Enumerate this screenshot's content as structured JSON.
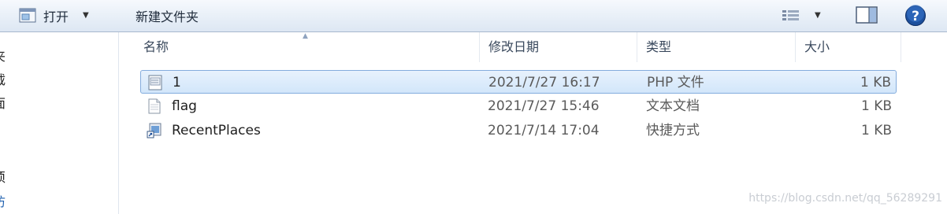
{
  "toolbar": {
    "open_label": "打开",
    "new_folder_label": "新建文件夹"
  },
  "nav": {
    "items": [
      "夹",
      "载",
      "面",
      "须",
      "访"
    ]
  },
  "columns": {
    "name": "名称",
    "date": "修改日期",
    "type": "类型",
    "size": "大小"
  },
  "files": [
    {
      "name": "1",
      "date": "2021/7/27 16:17",
      "type": "PHP 文件",
      "size": "1 KB",
      "icon": "php-file-icon",
      "selected": true
    },
    {
      "name": "flag",
      "date": "2021/7/27 15:46",
      "type": "文本文档",
      "size": "1 KB",
      "icon": "text-file-icon",
      "selected": false
    },
    {
      "name": "RecentPlaces",
      "date": "2021/7/14 17:04",
      "type": "快捷方式",
      "size": "1 KB",
      "icon": "shortcut-icon",
      "selected": false
    }
  ],
  "watermark": "https://blog.csdn.net/qq_56289291"
}
